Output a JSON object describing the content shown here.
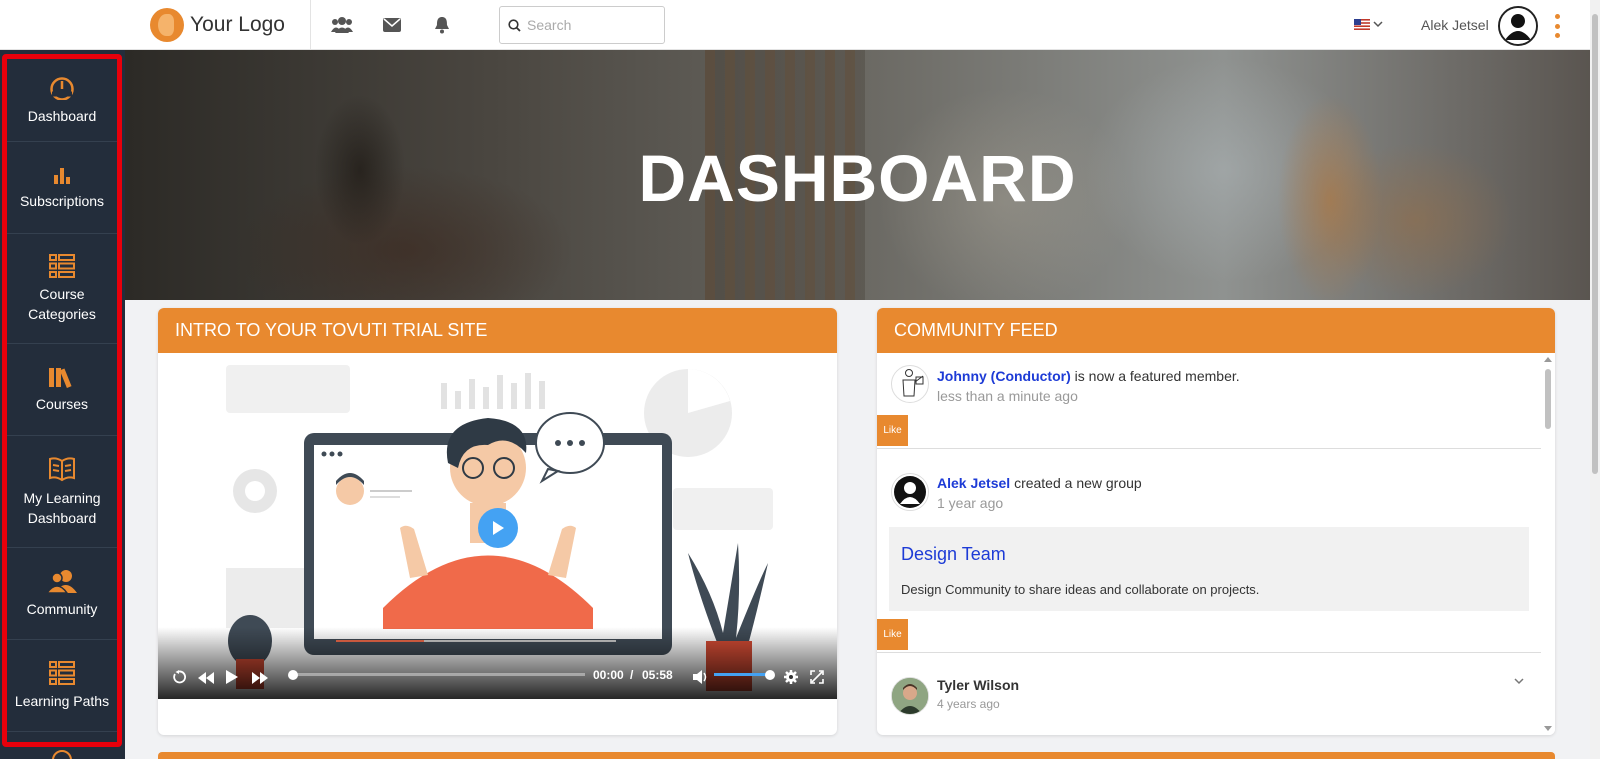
{
  "topbar": {
    "logo_text": "Your Logo",
    "search_placeholder": "Search",
    "user_name": "Alek Jetsel",
    "icons": [
      "users-icon",
      "mail-icon",
      "bell-icon",
      "search-icon",
      "us-flag-icon",
      "avatar",
      "kebab-menu-icon"
    ]
  },
  "sidebar": {
    "items": [
      {
        "label": "Dashboard",
        "icon": "speedometer-icon"
      },
      {
        "label": "Subscriptions",
        "icon": "bar-chart-icon"
      },
      {
        "label": "Course Categories",
        "icon": "list-grid-icon"
      },
      {
        "label": "Courses",
        "icon": "books-icon"
      },
      {
        "label": "My Learning Dashboard",
        "icon": "open-book-icon"
      },
      {
        "label": "Community",
        "icon": "community-icon"
      },
      {
        "label": "Learning Paths",
        "icon": "list-grid-icon"
      }
    ]
  },
  "hero": {
    "title": "DASHBOARD"
  },
  "video_panel": {
    "title": "INTRO TO YOUR TOVUTI TRIAL SITE",
    "current_time": "00:00",
    "separator": "/",
    "duration": "05:58",
    "progress": 0,
    "volume": 1
  },
  "community_feed": {
    "title": "COMMUNITY FEED",
    "like_label": "Like",
    "items": [
      {
        "user": "Johnny (Conductor)",
        "action": "is now a featured member.",
        "time": "less than a minute ago"
      },
      {
        "user": "Alek Jetsel",
        "action": "created a new group",
        "time": "1 year ago",
        "group": {
          "name": "Design Team",
          "description": "Design Community to share ideas and collaborate on projects."
        }
      },
      {
        "user": "Tyler Wilson",
        "action": "",
        "time": "4 years ago"
      }
    ]
  },
  "colors": {
    "accent": "#e8892f",
    "sidebar_bg": "#232d3b",
    "link": "#1d3bd6",
    "highlight_border": "#e8000b",
    "video_blue": "#44a2f3"
  }
}
